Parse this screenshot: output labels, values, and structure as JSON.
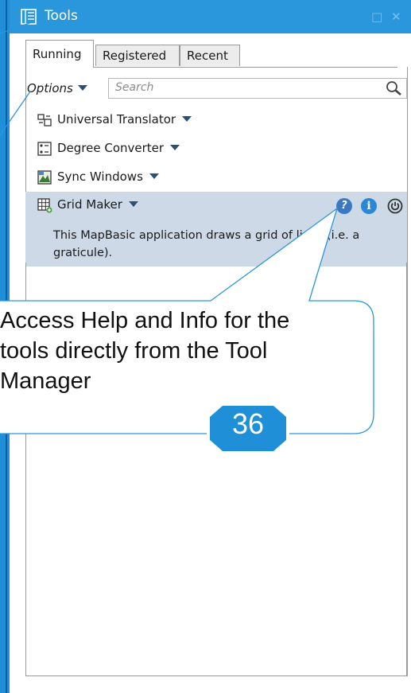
{
  "window": {
    "title": "Tools",
    "icons": {
      "app": "tools-window-icon",
      "maximize": "maximize-icon",
      "close": "close-icon"
    },
    "maximize_glyph": "□",
    "close_glyph": "✕"
  },
  "tabs": [
    {
      "label": "Running",
      "active": true
    },
    {
      "label": "Registered",
      "active": false
    },
    {
      "label": "Recent",
      "active": false
    }
  ],
  "toolbar": {
    "options_label": "Options",
    "search_placeholder": "Search",
    "search_icon": "search-icon"
  },
  "tools": [
    {
      "label": "Universal Translator",
      "icon": "translator-icon"
    },
    {
      "label": "Degree Converter",
      "icon": "degree-converter-icon"
    },
    {
      "label": "Sync Windows",
      "icon": "sync-windows-icon"
    },
    {
      "label": "Grid Maker",
      "icon": "grid-maker-icon",
      "selected": true,
      "description": "This MapBasic application draws a grid of lines (i.e. a graticule).",
      "help_glyph": "?",
      "info_glyph": "i"
    }
  ],
  "callout": {
    "text": "Access Help and Info for the tools directly from the Tool Manager",
    "badge": "36"
  },
  "colors": {
    "titlebar": "#2a96db",
    "accent_strip": "#1f8fd8",
    "selection": "#cdd9e6",
    "callout_border": "#2a96db",
    "badge": "#1f8fd8"
  }
}
